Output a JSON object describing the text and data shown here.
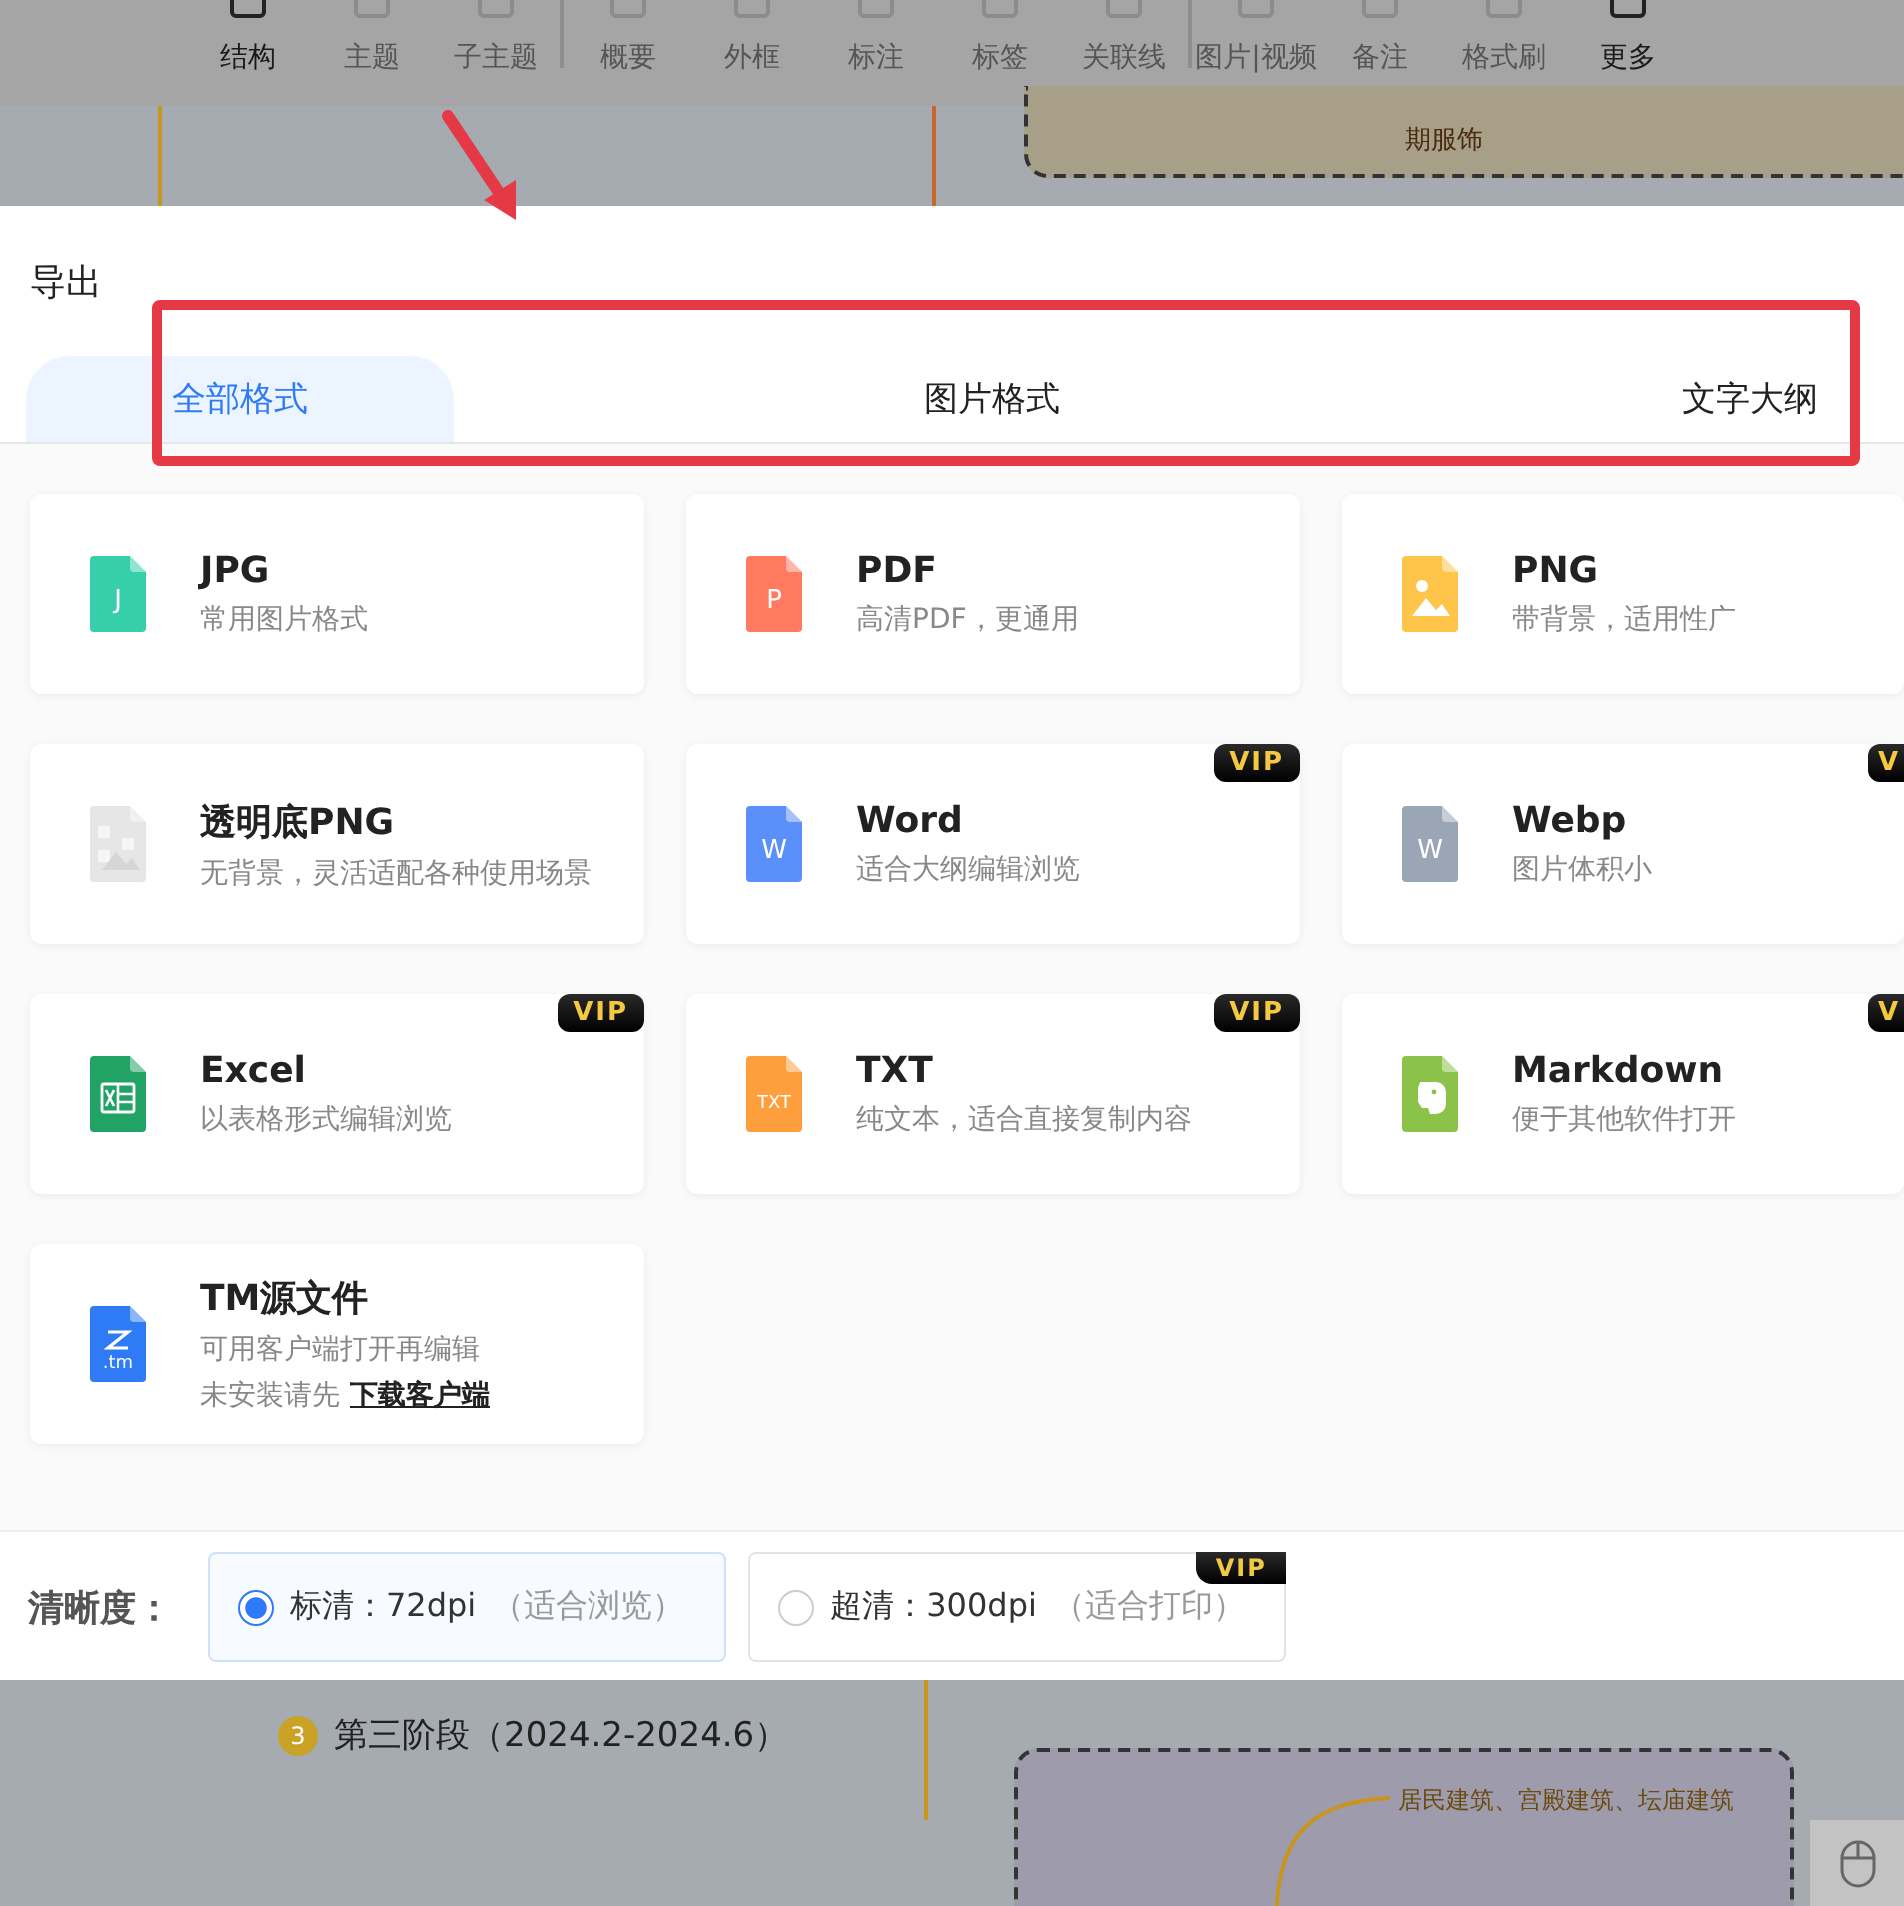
{
  "toolbar": {
    "groups": [
      [
        {
          "label": "结构",
          "disabled": false
        },
        {
          "label": "主题",
          "disabled": true
        },
        {
          "label": "子主题",
          "disabled": true
        }
      ],
      [
        {
          "label": "概要",
          "disabled": true
        },
        {
          "label": "外框",
          "disabled": true
        },
        {
          "label": "标注",
          "disabled": true
        },
        {
          "label": "标签",
          "disabled": true
        },
        {
          "label": "关联线",
          "disabled": true
        }
      ],
      [
        {
          "label": "图片|视频",
          "disabled": true
        },
        {
          "label": "备注",
          "disabled": true
        },
        {
          "label": "格式刷",
          "disabled": true
        },
        {
          "label": "更多",
          "disabled": false
        }
      ]
    ]
  },
  "canvas_top": {
    "node": "期服饰"
  },
  "dialog": {
    "title": "导出",
    "tabs": [
      {
        "label": "全部格式",
        "selected": true
      },
      {
        "label": "图片格式",
        "selected": false
      },
      {
        "label": "文字大纲",
        "selected": false
      }
    ],
    "formats": [
      {
        "kind": "letter",
        "name": "JPG",
        "desc": "常用图片格式",
        "glyph": "J",
        "color": "#36cfa9",
        "vip": false
      },
      {
        "kind": "letter",
        "name": "PDF",
        "desc": "高清PDF，更通用",
        "glyph": "P",
        "color": "#ff7a5f",
        "vip": false
      },
      {
        "kind": "image",
        "name": "PNG",
        "desc": "带背景，适用性广",
        "color": "#ffc54a",
        "vip": false
      },
      {
        "kind": "checker",
        "name": "透明底PNG",
        "desc": "无背景，灵活适配各种使用场景",
        "color": "#e6e6e6",
        "vip": false
      },
      {
        "kind": "letter",
        "name": "Word",
        "desc": "适合大纲编辑浏览",
        "glyph": "W",
        "color": "#5b8ff9",
        "vip": true,
        "vip_label": "VIP"
      },
      {
        "kind": "letter",
        "name": "Webp",
        "desc": "图片体积小",
        "glyph": "W",
        "color": "#9aa6b6",
        "vip": true,
        "vip_label": "V"
      },
      {
        "kind": "excel",
        "name": "Excel",
        "desc": "以表格形式编辑浏览",
        "color": "#21a366",
        "vip": true,
        "vip_label": "VIP"
      },
      {
        "kind": "letter",
        "name": "TXT",
        "desc": "纯文本，适合直接复制内容",
        "glyph": "TXT",
        "color": "#ff9e3d",
        "vip": true,
        "vip_label": "VIP"
      },
      {
        "kind": "elephant",
        "name": "Markdown",
        "desc": "便于其他软件打开",
        "color": "#8bc34a",
        "vip": true,
        "vip_label": "V"
      },
      {
        "kind": "tm",
        "name": "TM源文件",
        "desc": "可用客户端打开再编辑",
        "glyph": ".tm",
        "color": "#2f7bf6",
        "vip": false,
        "note": "未安装请先",
        "link": "下载客户端"
      }
    ],
    "resolution": {
      "label": "清晰度：",
      "options": [
        {
          "label": "标清：72dpi",
          "note": "（适合浏览）",
          "selected": true,
          "vip": false
        },
        {
          "label": "超清：300dpi",
          "note": "（适合打印）",
          "selected": false,
          "vip": true,
          "vip_label": "VIP"
        }
      ]
    }
  },
  "canvas_bottom": {
    "stage_number": "3",
    "stage": "第三阶段（2024.2-2024.6）",
    "node": "居民建筑、宫殿建筑、坛庙建筑"
  }
}
